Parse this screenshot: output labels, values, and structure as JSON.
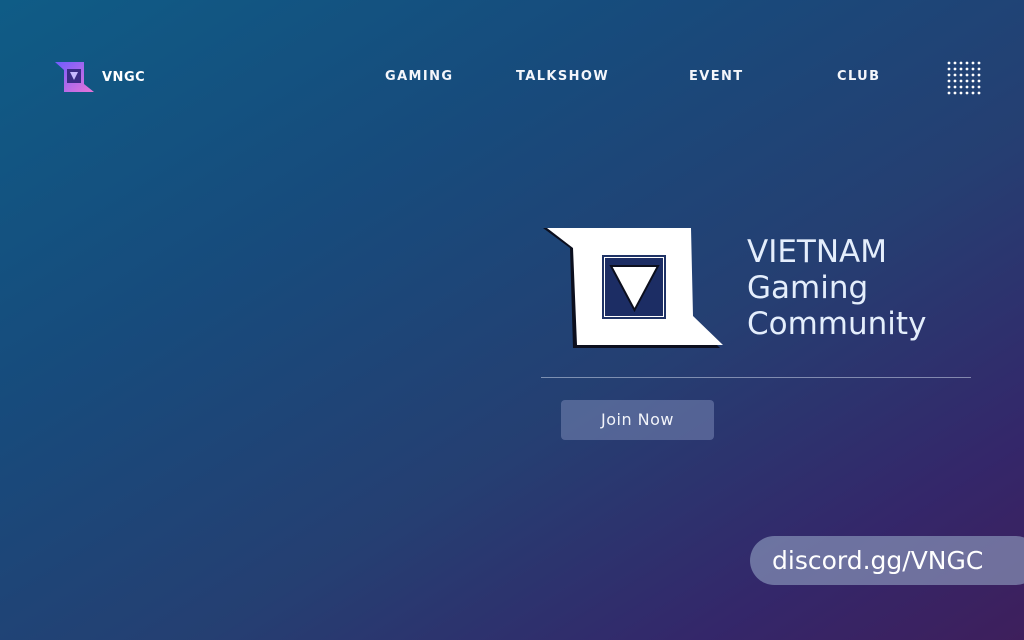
{
  "brand": {
    "name": "VNGC",
    "logo_icon": "vngc-logo-icon",
    "logo_colors": [
      "#7b5cff",
      "#e16bd8",
      "#3b2f8f"
    ]
  },
  "nav": {
    "items": [
      {
        "label": "GAMING"
      },
      {
        "label": "TALKSHOW"
      },
      {
        "label": "EVENT"
      },
      {
        "label": "CLUB"
      }
    ],
    "menu_icon": "grid-dots-icon"
  },
  "hero": {
    "logo_icon": "vngc-emblem-icon",
    "title_lines": [
      "VIETNAM",
      "Gaming",
      "Community"
    ],
    "cta_label": "Join Now"
  },
  "discord": {
    "link_text": "discord.gg/VNGC"
  },
  "colors": {
    "background_start": "#0f5c86",
    "background_end": "#3e1f5c",
    "title_text": "#e4eefc",
    "button_bg": "#7886b4"
  }
}
